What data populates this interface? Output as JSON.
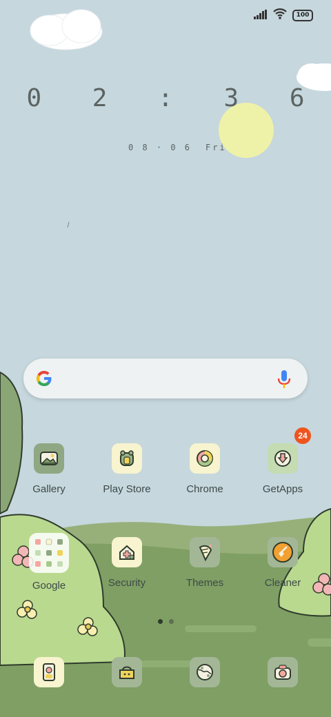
{
  "status_bar": {
    "battery_level": "100",
    "signal_icon": "signal-bars-icon",
    "wifi_icon": "wifi-icon"
  },
  "clock": {
    "time": "0 2 : 3 6",
    "date": "0 8 · 0 6",
    "weekday": "Fri"
  },
  "search": {
    "logo_icon": "google-g-icon",
    "mic_icon": "microphone-icon"
  },
  "apps_row1": [
    {
      "label": "Gallery",
      "icon": "gallery-icon"
    },
    {
      "label": "Play Store",
      "icon": "play-store-icon"
    },
    {
      "label": "Chrome",
      "icon": "chrome-icon"
    },
    {
      "label": "GetApps",
      "icon": "getapps-icon",
      "badge": "24"
    }
  ],
  "apps_row2": [
    {
      "label": "Google",
      "icon": "google-folder-icon"
    },
    {
      "label": "Security",
      "icon": "security-icon"
    },
    {
      "label": "Themes",
      "icon": "themes-icon"
    },
    {
      "label": "Cleaner",
      "icon": "cleaner-icon"
    }
  ],
  "dock": [
    {
      "icon": "phone-icon"
    },
    {
      "icon": "messages-icon"
    },
    {
      "icon": "browser-icon"
    },
    {
      "icon": "camera-icon"
    }
  ],
  "page_indicator": {
    "pages": 2,
    "current": 1
  },
  "colors": {
    "sky": "#c6d7dd",
    "grass": "#7f9f64",
    "bush": "#b9d98f",
    "badge": "#f0541e",
    "sun": "#eef2a8"
  }
}
